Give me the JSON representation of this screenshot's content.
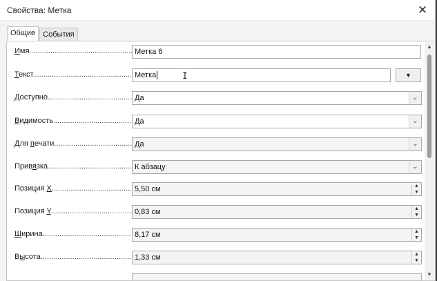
{
  "window": {
    "title": "Свойства: Метка"
  },
  "tabs": [
    {
      "label": "Общие",
      "active": true
    },
    {
      "label": "События",
      "active": false
    }
  ],
  "fields": {
    "name": {
      "label_pre": "",
      "label_u": "И",
      "label_post": "мя",
      "value": "Метка 6"
    },
    "text": {
      "label_pre": "",
      "label_u": "Т",
      "label_post": "екст",
      "value": "Метка",
      "button_icon": "▼"
    },
    "enabled": {
      "label_pre": "",
      "label_u": "",
      "label_post": "Доступно",
      "value": "Да"
    },
    "visible": {
      "label_pre": "",
      "label_u": "В",
      "label_post": "идимость",
      "value": "Да"
    },
    "print": {
      "label_pre": "Для ",
      "label_u": "п",
      "label_post": "ечати",
      "value": "Да"
    },
    "anchor": {
      "label_pre": "Прив",
      "label_u": "я",
      "label_post": "зка",
      "value": "К абзацу"
    },
    "pos_x": {
      "label_pre": "Позиция ",
      "label_u": "X",
      "label_post": "",
      "value": "5,50 см"
    },
    "pos_y": {
      "label_pre": "Позиция ",
      "label_u": "Y",
      "label_post": "",
      "value": "0,83 см"
    },
    "width": {
      "label_pre": "",
      "label_u": "Ш",
      "label_post": "ирина",
      "value": "8,17 см"
    },
    "height": {
      "label_pre": "В",
      "label_u": "ы",
      "label_post": "сота",
      "value": "1,33 см"
    }
  },
  "dots": "...............................................................",
  "icons": {
    "close": "close-icon",
    "dropdown": "chevron-down-icon",
    "spin": "spin-up-down-icon",
    "scroll_up": "scroll-up-icon",
    "scroll_down": "scroll-down-icon"
  }
}
